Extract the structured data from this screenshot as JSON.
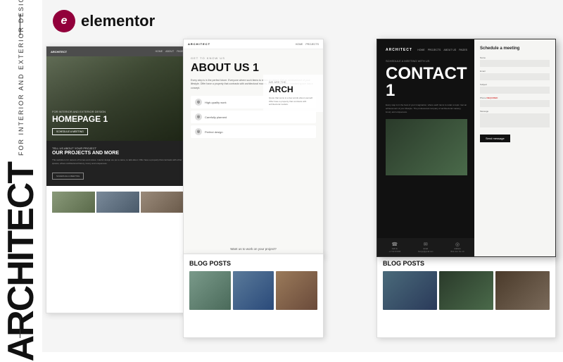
{
  "sidebar": {
    "subtitle": "FOR INTERIOR AND EXTERIOR DESIGN",
    "title": "ARCHITECT"
  },
  "elementor": {
    "icon_letter": "e",
    "label": "elementor"
  },
  "homepage_mockup": {
    "logo": "ARCHITECT",
    "nav": [
      "HOME",
      "ABOUT",
      "PAGES"
    ],
    "hero_subtitle": "FOR INTERIOR AND EXTERIOR DESIGN",
    "hero_title": "HOMEPAGE 1",
    "hero_button": "SCHEDULE A MEETING",
    "section_label": "TELL US ABOUT YOUR PROJECT",
    "section_heading": "OUR PROJECTS AND MORE",
    "section_text": "This website is for owners of homes and stores. Interior design we put a name, to talk about. Offer have a property that contrasts with other spaces, where architectural history, luxury and uniqueness.",
    "section_button": "SCHEDULE A MEETING"
  },
  "about_mockup": {
    "logo": "ARCHITECT",
    "nav": [
      "HOME",
      "PROJECTS"
    ],
    "label": "GET TO KNOW US",
    "title": "ABOUT US 1",
    "text": "Every step is in the perfect future. Everyone where such items to retain an object. Get an achievement of your lifestyle. Offer have a property that contrasts with architectural models. Every content offer constant space has a concept.",
    "features": [
      {
        "icon": "◎",
        "text": "High-quality work"
      },
      {
        "icon": "◎",
        "text": "Carefully planned"
      },
      {
        "icon": "◎",
        "text": "Perfect design"
      }
    ],
    "we_are_label": "WE ARE THE",
    "we_are_title": "ARCH",
    "we_are_text": "Quote that sums to a few words about yourself. Offer have a property that contrasts with architectural models.",
    "work_with_us": "Want us to work on your project?"
  },
  "contact_mockup": {
    "logo": "ARCHITECT",
    "nav": [
      "HOME",
      "PROJECTS",
      "ABOUT US",
      "PAGES"
    ],
    "schedule_label": "SCHEDULE A MEETING WITH US",
    "title": "CONTACT 1",
    "description": "Every step is in the best of your imagination, where each items to retain a topic. Get an achievement of your lifestyle. The professional company of architectural mastery, luxury and uniqueness.",
    "form_title": "Schedule a meeting",
    "form_fields": [
      {
        "label": "Name",
        "placeholder": ""
      },
      {
        "label": "Email",
        "placeholder": ""
      },
      {
        "label": "Subject",
        "placeholder": ""
      },
      {
        "label": "Phone",
        "placeholder": "REQUIRED"
      },
      {
        "label": "Message",
        "placeholder": ""
      }
    ],
    "form_button": "Send message",
    "bottom_items": [
      {
        "icon": "☎",
        "label": "Call Us",
        "value": "+1 764 547295"
      },
      {
        "icon": "✉",
        "label": "Email",
        "value": "Design@gmail.com"
      },
      {
        "icon": "◎",
        "label": "Address",
        "value": "Bivd. Ave. Number 19..."
      }
    ]
  },
  "blog_center": {
    "title": "BLOG POSTS"
  },
  "blog_right": {
    "title": "BLOG POSTS"
  }
}
